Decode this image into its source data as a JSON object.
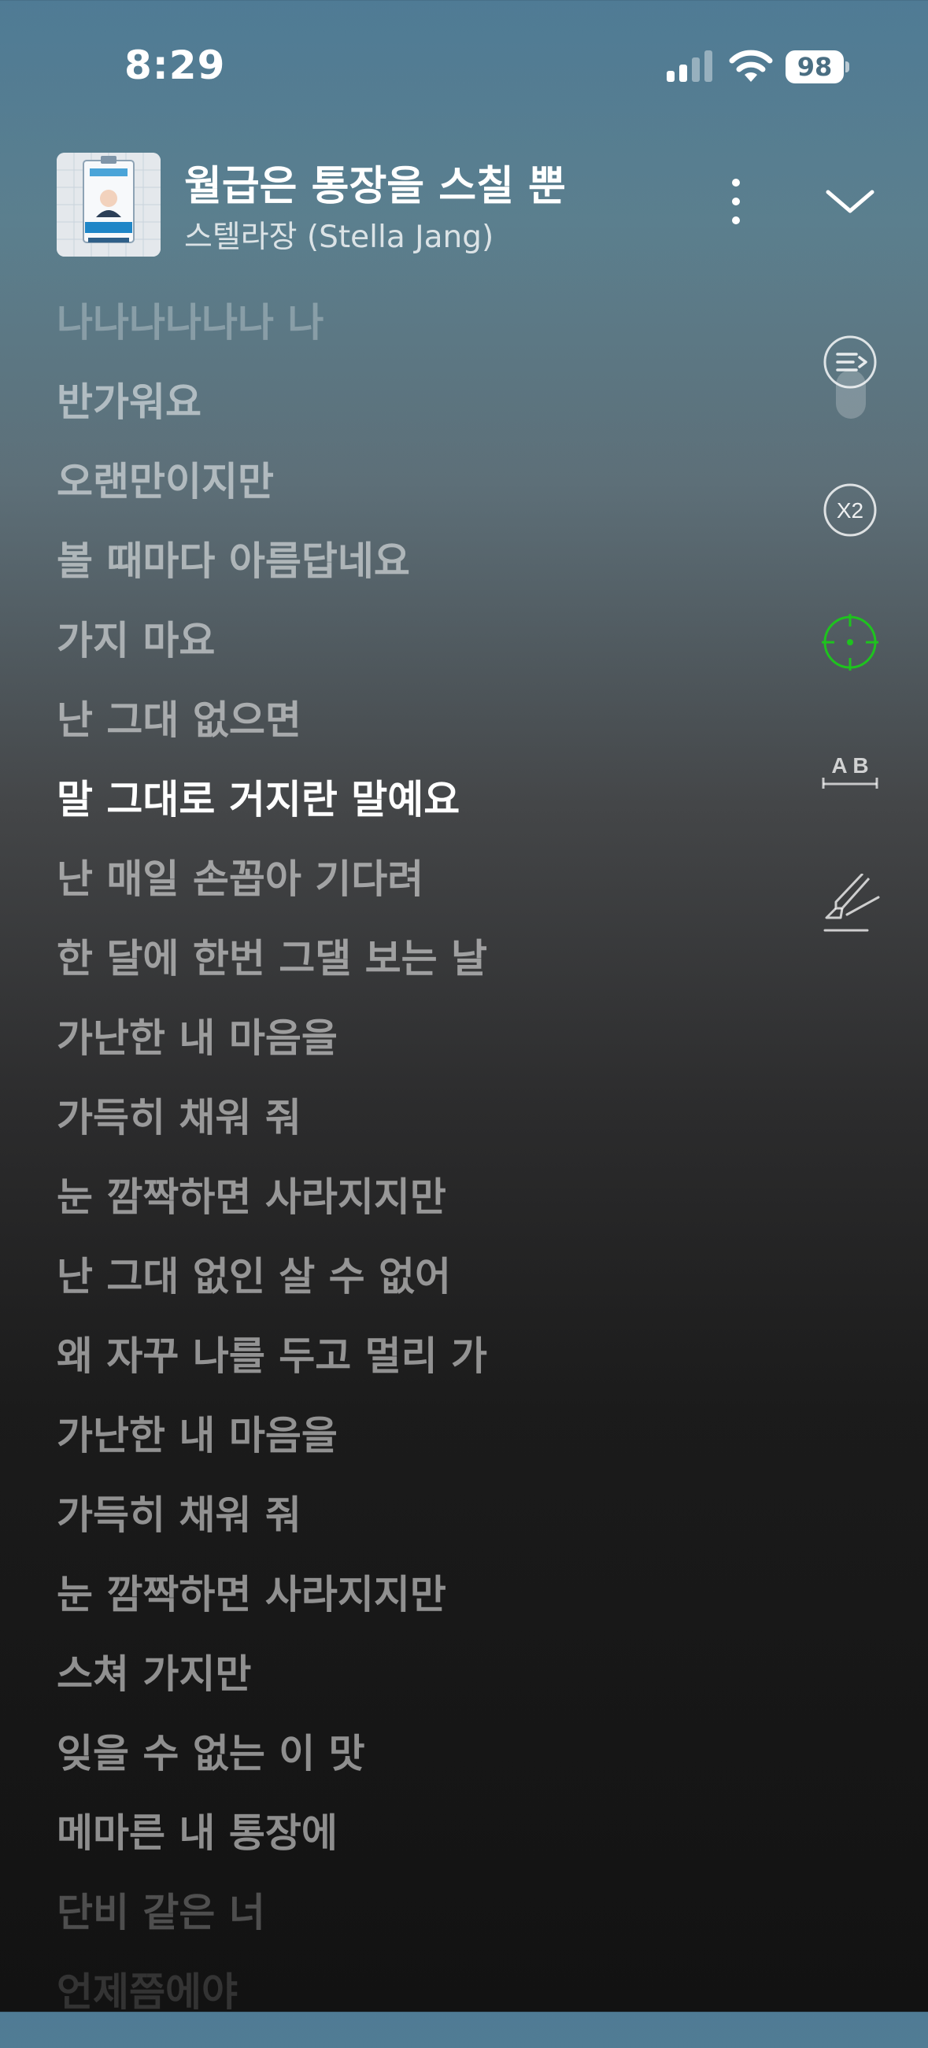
{
  "status_bar": {
    "time": "8:29",
    "battery": "98"
  },
  "now_playing": {
    "title": "월급은 통장을 스칠 뿐",
    "artist": "스텔라장 (Stella Jang)"
  },
  "lyrics": [
    {
      "text": "나나나나나나 나",
      "state": "faded-top"
    },
    {
      "text": "반가워요",
      "state": "inactive"
    },
    {
      "text": "오랜만이지만",
      "state": "inactive"
    },
    {
      "text": "볼 때마다 아름답네요",
      "state": "inactive"
    },
    {
      "text": "가지 마요",
      "state": "inactive"
    },
    {
      "text": "난 그대 없으면",
      "state": "inactive"
    },
    {
      "text": "말 그대로 거지란 말예요",
      "state": "active"
    },
    {
      "text": "난 매일 손꼽아 기다려",
      "state": "inactive"
    },
    {
      "text": "한 달에 한번 그댈 보는 날",
      "state": "inactive"
    },
    {
      "text": "가난한 내 마음을",
      "state": "inactive"
    },
    {
      "text": "가득히 채워 줘",
      "state": "inactive"
    },
    {
      "text": "눈 깜짝하면 사라지지만",
      "state": "inactive"
    },
    {
      "text": "난 그대 없인 살 수 없어",
      "state": "inactive"
    },
    {
      "text": "왜 자꾸 나를 두고 멀리 가",
      "state": "inactive"
    },
    {
      "text": "가난한 내 마음을",
      "state": "inactive"
    },
    {
      "text": "가득히 채워 줘",
      "state": "inactive"
    },
    {
      "text": "눈 깜짝하면 사라지지만",
      "state": "inactive"
    },
    {
      "text": "스쳐 가지만",
      "state": "inactive"
    },
    {
      "text": "잊을 수 없는 이 맛",
      "state": "inactive"
    },
    {
      "text": "메마른 내 통장에",
      "state": "inactive"
    },
    {
      "text": "단비 같은 너",
      "state": "faded-bottom"
    },
    {
      "text": "언제쯤에야",
      "state": "faded-bottom-more"
    }
  ],
  "tools": {
    "speed_label": "X2",
    "ab_label": "A B"
  },
  "colors": {
    "accent_sync": "#1ec31e",
    "active_lyric": "#ffffff"
  },
  "icons": [
    "signal-icon",
    "wifi-icon",
    "battery-icon",
    "more-vertical-icon",
    "chevron-down-icon",
    "queue-icon",
    "speed-icon",
    "sync-target-icon",
    "ab-repeat-icon",
    "highlighter-icon"
  ]
}
